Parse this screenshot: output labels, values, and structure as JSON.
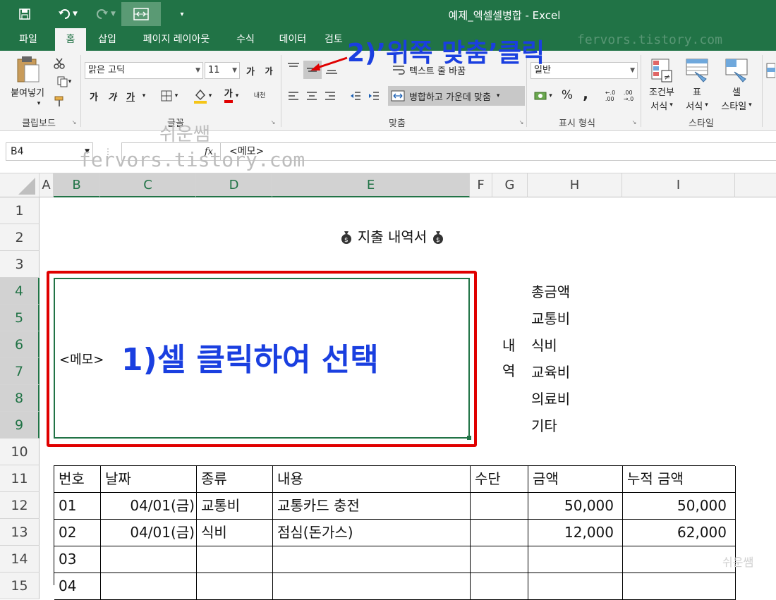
{
  "window": {
    "title": "예제_엑셀셀병합 - Excel"
  },
  "quick_access": {
    "save": "save-icon",
    "undo": "undo-icon",
    "redo": "redo-icon"
  },
  "tabs": [
    {
      "label": "파일"
    },
    {
      "label": "홈"
    },
    {
      "label": "삽입"
    },
    {
      "label": "페이지 레이아웃"
    },
    {
      "label": "수식"
    },
    {
      "label": "데이터"
    },
    {
      "label": "검토"
    }
  ],
  "ribbon": {
    "clipboard": {
      "paste_label": "붙여넣기",
      "group_label": "클립보드"
    },
    "font": {
      "font_name": "맑은 고딕",
      "font_size": "11",
      "grow": "가",
      "shrink": "가",
      "bold": "가",
      "italic": "가",
      "underline": "가",
      "color_glyph": "가",
      "phonetic": "내천",
      "group_label": "글꼴"
    },
    "alignment": {
      "wrap_text": "텍스트 줄 바꿈",
      "merge_center": "병합하고 가운데 맞춤",
      "group_label": "맞춤"
    },
    "number": {
      "format": "일반",
      "percent": "%",
      "comma": ",",
      "group_label": "표시 형식"
    },
    "styles": {
      "conditional_line1": "조건부",
      "conditional_line2": "서식",
      "table_line1": "표",
      "table_line2": "서식",
      "cell_line1": "셀",
      "cell_line2": "스타일",
      "group_label": "스타일"
    }
  },
  "formula_bar": {
    "name_box": "B4",
    "fx": "fx",
    "content": "<메모>"
  },
  "columns": [
    "A",
    "B",
    "C",
    "D",
    "E",
    "F",
    "G",
    "H",
    "I"
  ],
  "rows": [
    "1",
    "2",
    "3",
    "4",
    "5",
    "6",
    "7",
    "8",
    "9",
    "10",
    "11",
    "12",
    "13",
    "14",
    "15"
  ],
  "sheet": {
    "title": "지출 내역서",
    "memo": "<메모>",
    "side_label": [
      "내",
      "역"
    ],
    "categories": [
      "총금액",
      "교통비",
      "식비",
      "교육비",
      "의료비",
      "기타"
    ],
    "table_headers": [
      "번호",
      "날짜",
      "종류",
      "내용",
      "수단",
      "금액",
      "누적 금액"
    ],
    "table_rows": [
      [
        "01",
        "04/01(금)",
        "교통비",
        "교통카드 충전",
        "",
        "50,000",
        "50,000"
      ],
      [
        "02",
        "04/01(금)",
        "식비",
        "점심(돈가스)",
        "",
        "12,000",
        "62,000"
      ],
      [
        "03",
        "",
        "",
        "",
        "",
        "",
        ""
      ],
      [
        "04",
        "",
        "",
        "",
        "",
        "",
        ""
      ]
    ]
  },
  "annotations": {
    "step1": "1)셀 클릭하여 선택",
    "step2": "2)’위쪽 맞춤’클릭"
  },
  "watermarks": {
    "main": "fervors.tistory.com",
    "tr": "fervors.tistory.com",
    "corner": "쉬운쌤",
    "korean": "쉬운쌤"
  },
  "colors": {
    "excel_green": "#217346",
    "annotation_blue": "#1a3fe0",
    "highlight_red": "#e00000"
  }
}
